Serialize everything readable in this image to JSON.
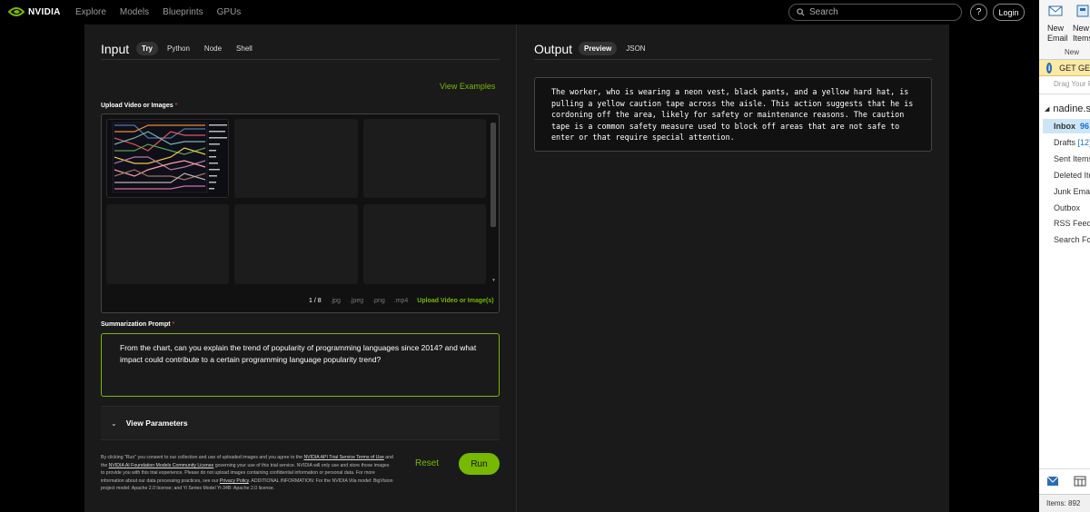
{
  "nav": {
    "brand": "NVIDIA",
    "links": [
      "Explore",
      "Models",
      "Blueprints",
      "GPUs"
    ],
    "search_placeholder": "Search",
    "help": "?",
    "login": "Login",
    "accent": "#76b900"
  },
  "input": {
    "title": "Input",
    "tabs": [
      "Try",
      "Python",
      "Node",
      "Shell"
    ],
    "active_tab": "Try",
    "view_examples": "View Examples",
    "upload_label": "Upload Video or Images",
    "required_mark": "*",
    "page_indicator": "1 / 8",
    "formats": [
      ".jpg",
      ".jpeg",
      ".png",
      ".mp4"
    ],
    "upload_link": "Upload Video or Image(s)",
    "prompt_label": "Summarization Prompt",
    "prompt_text": "From the chart, can you explain the trend of popularity of programming languages since 2014? and what impact could contribute to a certain programming language popularity trend?",
    "view_parameters": "View Parameters",
    "legal": {
      "p1": "By clicking \"Run\" you consent to our collection and use of uploaded images and you agree to the ",
      "link1": "NVIDIA API Trial Service Terms of Use",
      "p2": " and the ",
      "link2": "NVIDIA AI Foundation Models Community License",
      "p3": " governing your use of this trial service. NVIDIA will only use and store those images to provide you with this trial experience. Please do not upload images containing confidential information or personal data. For more information about our data processing practices, see our ",
      "link3": "Privacy Policy",
      "p4": ". ADDITIONAL INFORMATION: For the NVIDIA Vila model: BigVision project model: Apache 2.0 license; and Yi Series Model Yi-34B: Apache 2.0 license."
    },
    "reset": "Reset",
    "run": "Run"
  },
  "output": {
    "title": "Output",
    "tabs": [
      "Preview",
      "JSON"
    ],
    "active_tab": "Preview",
    "text": "The worker, who is wearing a neon vest, black pants, and a yellow hard hat, is pulling a yellow caution tape across the aisle. This action suggests that he is cordoning off the area, likely for safety or maintenance reasons. The caution tape is a common safety measure used to block off areas that are not safe to enter or that require special attention."
  },
  "outlook": {
    "buttons": [
      {
        "line1": "New",
        "line2": "Email"
      },
      {
        "line1": "New",
        "line2": "Items"
      }
    ],
    "group_label": "New",
    "banner": "GET GE",
    "drag_hint": "Drag Your F",
    "account": "nadine.sa",
    "folders": [
      {
        "name": "Inbox",
        "count": "96"
      },
      {
        "name": "Drafts",
        "count": "[12]"
      },
      {
        "name": "Sent Items",
        "count": ""
      },
      {
        "name": "Deleted Ite",
        "count": ""
      },
      {
        "name": "Junk Email",
        "count": ""
      },
      {
        "name": "Outbox",
        "count": ""
      },
      {
        "name": "RSS Feeds",
        "count": ""
      },
      {
        "name": "Search Fol",
        "count": ""
      }
    ],
    "status": "Items: 892"
  }
}
